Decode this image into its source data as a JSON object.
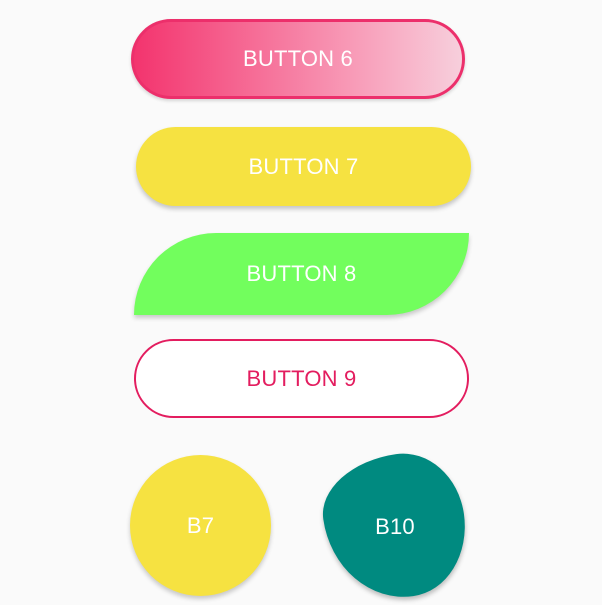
{
  "buttons": {
    "button6": {
      "label": "BUTTON 6"
    },
    "button7": {
      "label": "BUTTON 7"
    },
    "button8": {
      "label": "BUTTON 8"
    },
    "button9": {
      "label": "BUTTON 9"
    },
    "b7": {
      "label": "B7"
    },
    "b10": {
      "label": "B10"
    }
  },
  "colors": {
    "pink": "#f3346e",
    "pink_border": "#ec2f6b",
    "yellow": "#f6e241",
    "green": "#72fe5d",
    "outline_pink": "#e31d5f",
    "teal": "#008a80",
    "background": "#fafafa"
  }
}
